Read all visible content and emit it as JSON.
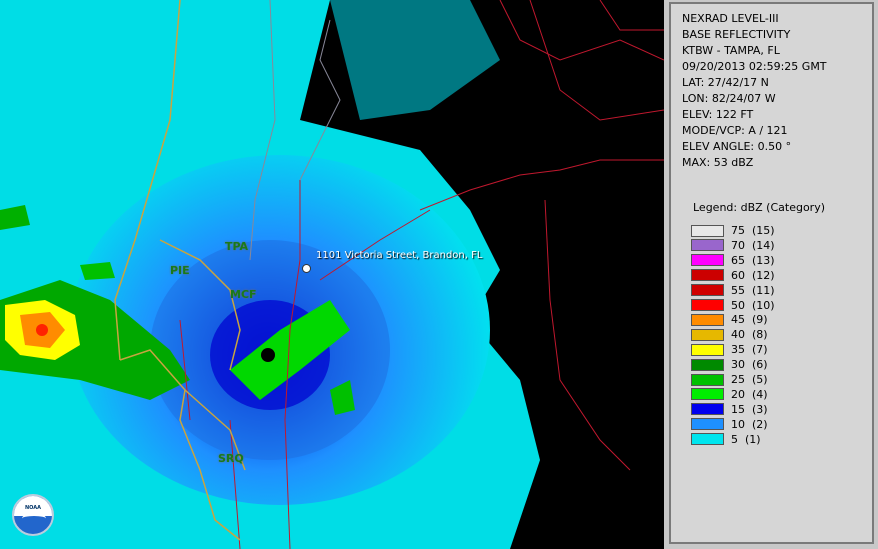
{
  "header_lines": [
    "NEXRAD LEVEL-III",
    "BASE REFLECTIVITY",
    "KTBW - TAMPA, FL",
    "09/20/2013 02:59:25 GMT",
    "LAT: 27/42/17 N",
    "LON: 82/24/07 W",
    "ELEV: 122 FT",
    "MODE/VCP: A / 121"
  ],
  "scan_lines": [
    "ELEV ANGLE: 0.50 °",
    "MAX: 53 dBZ"
  ],
  "legend": {
    "title": "Legend: dBZ (Category)",
    "items": [
      {
        "label": "75  (15)",
        "color": "#e8e8e8"
      },
      {
        "label": "70  (14)",
        "color": "#9966cc"
      },
      {
        "label": "65  (13)",
        "color": "#ff00ff"
      },
      {
        "label": "60  (12)",
        "color": "#cc0000"
      },
      {
        "label": "55  (11)",
        "color": "#d00000"
      },
      {
        "label": "50  (10)",
        "color": "#ff0000"
      },
      {
        "label": "45  (9)",
        "color": "#ff8c00"
      },
      {
        "label": "40  (8)",
        "color": "#e6b800"
      },
      {
        "label": "35  (7)",
        "color": "#ffff00"
      },
      {
        "label": "30  (6)",
        "color": "#008a00"
      },
      {
        "label": "25  (5)",
        "color": "#00c000"
      },
      {
        "label": "20  (4)",
        "color": "#00ee00"
      },
      {
        "label": "15  (3)",
        "color": "#0000ee"
      },
      {
        "label": "10  (2)",
        "color": "#1e90ff"
      },
      {
        "label": "5  (1)",
        "color": "#00e5ee"
      }
    ]
  },
  "map": {
    "cities": [
      "TPA",
      "PIE",
      "MCF",
      "SRQ"
    ],
    "location_label": "1101 Victoria Street, Brandon, FL",
    "logo_text": "NOAA"
  }
}
